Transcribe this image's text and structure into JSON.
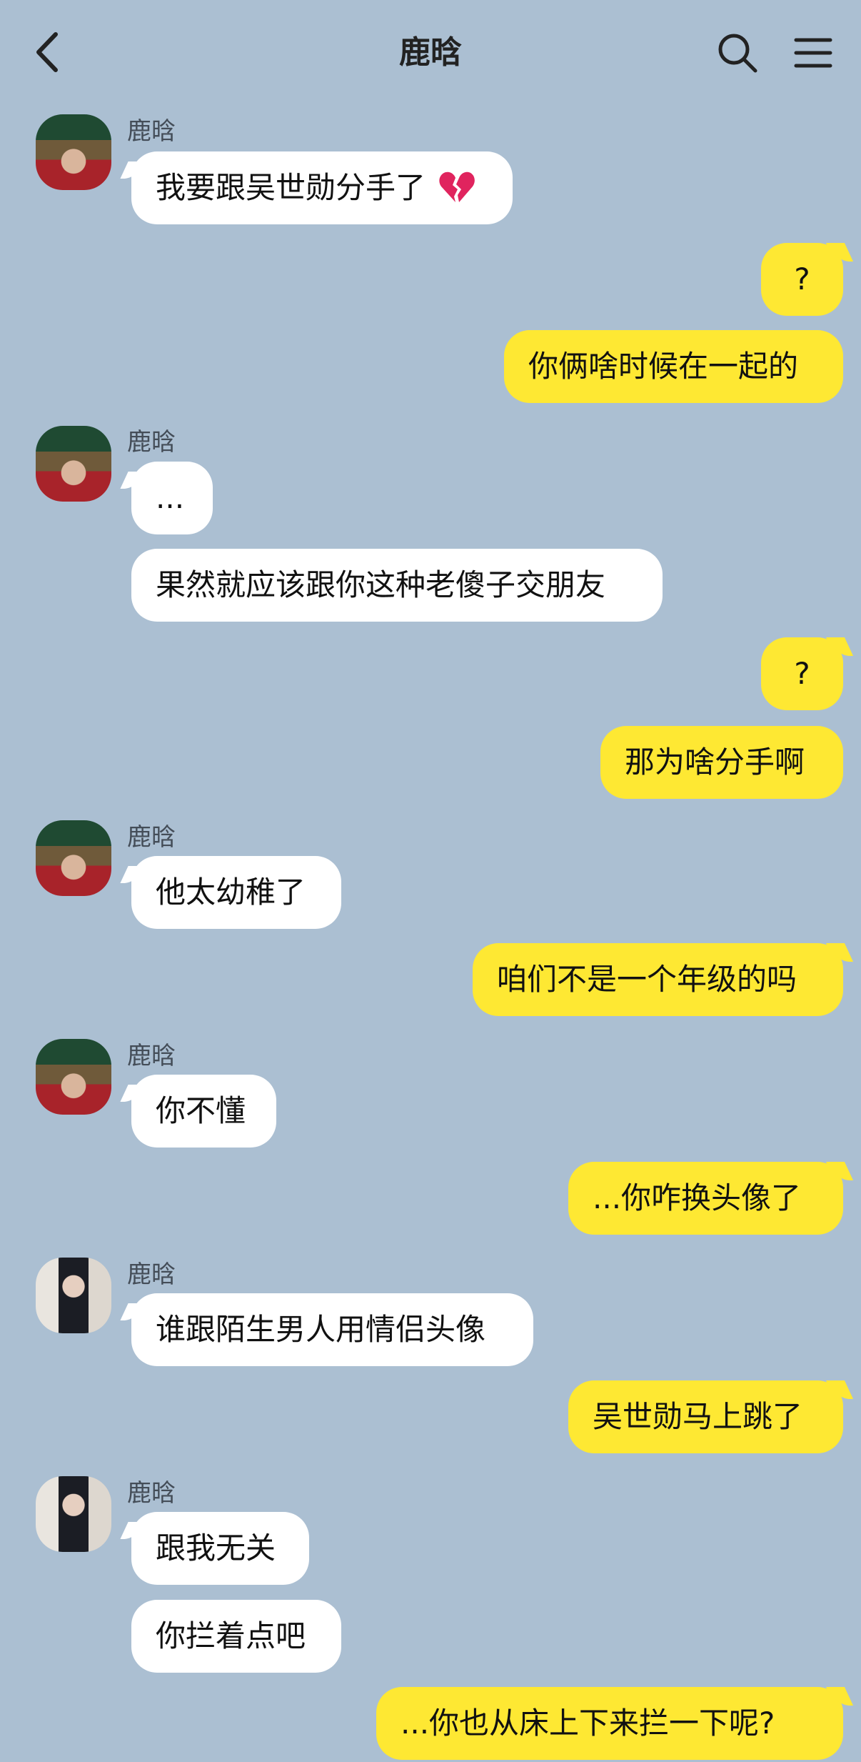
{
  "header": {
    "title": "鹿晗"
  },
  "messages": [
    {
      "side": "in",
      "sender": "鹿晗",
      "avatar": "avatar-1",
      "text": "我要跟吴世勋分手了",
      "emoji": "broken-heart-icon"
    },
    {
      "side": "out",
      "text": "?"
    },
    {
      "side": "out",
      "text": "你俩啥时候在一起的"
    },
    {
      "side": "in",
      "sender": "鹿晗",
      "avatar": "avatar-1",
      "text": "..."
    },
    {
      "side": "in",
      "text": "果然就应该跟你这种老傻子交朋友"
    },
    {
      "side": "out",
      "text": "?"
    },
    {
      "side": "out",
      "text": "那为啥分手啊"
    },
    {
      "side": "in",
      "sender": "鹿晗",
      "avatar": "avatar-1",
      "text": "他太幼稚了"
    },
    {
      "side": "out",
      "text": "咱们不是一个年级的吗"
    },
    {
      "side": "in",
      "sender": "鹿晗",
      "avatar": "avatar-1",
      "text": "你不懂"
    },
    {
      "side": "out",
      "text": "...你咋换头像了"
    },
    {
      "side": "in",
      "sender": "鹿晗",
      "avatar": "avatar-2",
      "text": "谁跟陌生男人用情侣头像"
    },
    {
      "side": "out",
      "text": "吴世勋马上跳了"
    },
    {
      "side": "in",
      "sender": "鹿晗",
      "avatar": "avatar-2",
      "text": "跟我无关"
    },
    {
      "side": "in",
      "text": "你拦着点吧"
    },
    {
      "side": "out",
      "text": "...你也从床上下来拦一下呢?"
    }
  ],
  "colors": {
    "background": "#abbfd2",
    "incoming_bubble": "#ffffff",
    "outgoing_bubble": "#fee833"
  },
  "icons": {
    "back": "back-arrow-icon",
    "search": "search-icon",
    "menu": "menu-icon"
  }
}
